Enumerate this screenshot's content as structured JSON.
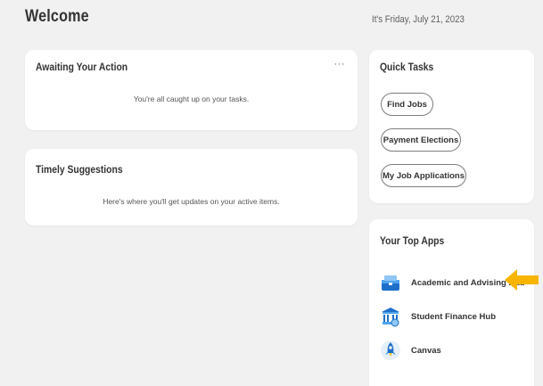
{
  "header": {
    "title": "Welcome",
    "date": "It's Friday, July 21, 2023"
  },
  "awaiting": {
    "title": "Awaiting Your Action",
    "more": "···",
    "message": "You're all caught up on your tasks."
  },
  "suggestions": {
    "title": "Timely Suggestions",
    "message": "Here's where you'll get updates on your active items."
  },
  "quick_tasks": {
    "title": "Quick Tasks",
    "items": [
      {
        "label": "Find Jobs"
      },
      {
        "label": "Payment Elections"
      },
      {
        "label": "My Job Applications"
      }
    ]
  },
  "top_apps": {
    "title": "Your Top Apps",
    "items": [
      {
        "label": "Academic and Advising Hub",
        "icon": "academic-hub-icon"
      },
      {
        "label": "Student Finance Hub",
        "icon": "student-finance-icon"
      },
      {
        "label": "Canvas",
        "icon": "canvas-rocket-icon"
      }
    ]
  },
  "colors": {
    "background": "#f1f1f1",
    "card": "#ffffff",
    "arrow": "#f7b500",
    "icon_blue": "#1e6fc9"
  }
}
